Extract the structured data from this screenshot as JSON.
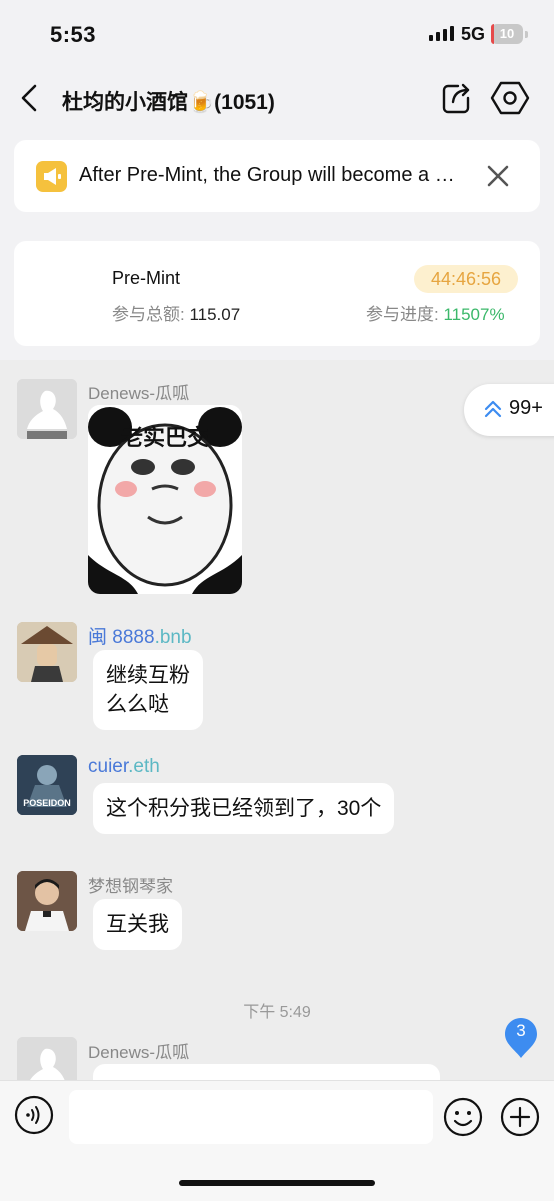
{
  "status": {
    "time": "5:53",
    "network": "5G",
    "battery": "10",
    "battery_level_percent": 10
  },
  "header": {
    "title": "杜均的小酒馆🍺(1051)"
  },
  "notice": {
    "text": "After Pre-Mint, the Group will become a paid group. Only NFT holders can stay."
  },
  "premint": {
    "title": "Pre-Mint",
    "timer": "44:46:56",
    "total_label": "参与总额: ",
    "total_value": "115.07",
    "progress_label": "参与进度: ",
    "progress_value": "11507%"
  },
  "unread_jump": {
    "count": "99+"
  },
  "messages": [
    {
      "sender": "Denews-瓜呱",
      "type": "sticker",
      "sticker_text": "老实巴交"
    },
    {
      "sender_prefix": "闽",
      "sender_main": "8888",
      "sender_suffix": ".bnb",
      "type": "text",
      "text_line1": "继续互粉",
      "text_line2": "么么哒"
    },
    {
      "sender_main": "cuier",
      "sender_suffix": ".eth",
      "type": "text",
      "text": "这个积分我已经领到了，30个",
      "avatar_text": "POSEIDON"
    },
    {
      "sender": "梦想钢琴家",
      "type": "text",
      "text": "互关我"
    },
    {
      "sender": "Denews-瓜呱",
      "type": "text",
      "text": ""
    }
  ],
  "timestamp": "下午 5:49",
  "new_badge": "3",
  "colors": {
    "accent_blue": "#4a79d8",
    "accent_teal": "#5cb8c4",
    "timer_orange": "#e6a540",
    "progress_green": "#3bb86a",
    "badge_blue": "#3d8cf0"
  }
}
